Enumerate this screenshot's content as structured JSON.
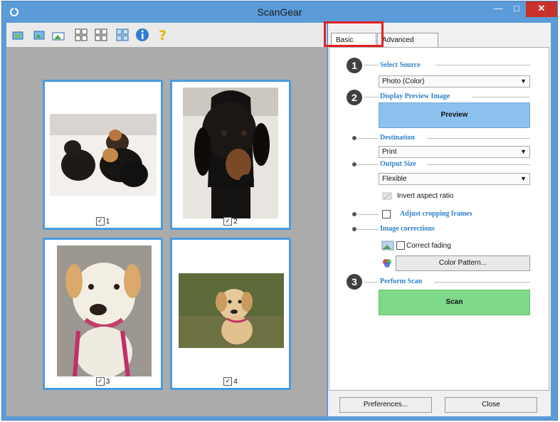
{
  "window": {
    "title": "ScanGear"
  },
  "tabs": [
    {
      "label": "Basic Mode",
      "active": true
    },
    {
      "label": "Advanced Mode",
      "active": false
    }
  ],
  "steps": {
    "s1": {
      "number": "1",
      "label": "Select Source",
      "value": "Photo (Color)"
    },
    "s2": {
      "number": "2",
      "label": "Display Preview Image",
      "button": "Preview"
    },
    "destination": {
      "label": "Destination",
      "value": "Print"
    },
    "output": {
      "label": "Output Size",
      "value": "Flexible",
      "invert_label": "Invert aspect ratio"
    },
    "crop": {
      "label": "Adjust cropping frames"
    },
    "corrections": {
      "label": "Image corrections",
      "fading_label": "Correct fading",
      "color_button": "Color Pattern..."
    },
    "s3": {
      "number": "3",
      "label": "Perform Scan",
      "button": "Scan"
    }
  },
  "footer": {
    "preferences": "Preferences...",
    "close": "Close"
  },
  "thumbnails": [
    {
      "number": "1",
      "checked": true
    },
    {
      "number": "2",
      "checked": true
    },
    {
      "number": "3",
      "checked": true
    },
    {
      "number": "4",
      "checked": true
    }
  ],
  "colors": {
    "accent": "#2f80c8",
    "highlight": "#e02020",
    "preview_btn": "#8ec2ee",
    "scan_btn": "#7fd98a"
  }
}
